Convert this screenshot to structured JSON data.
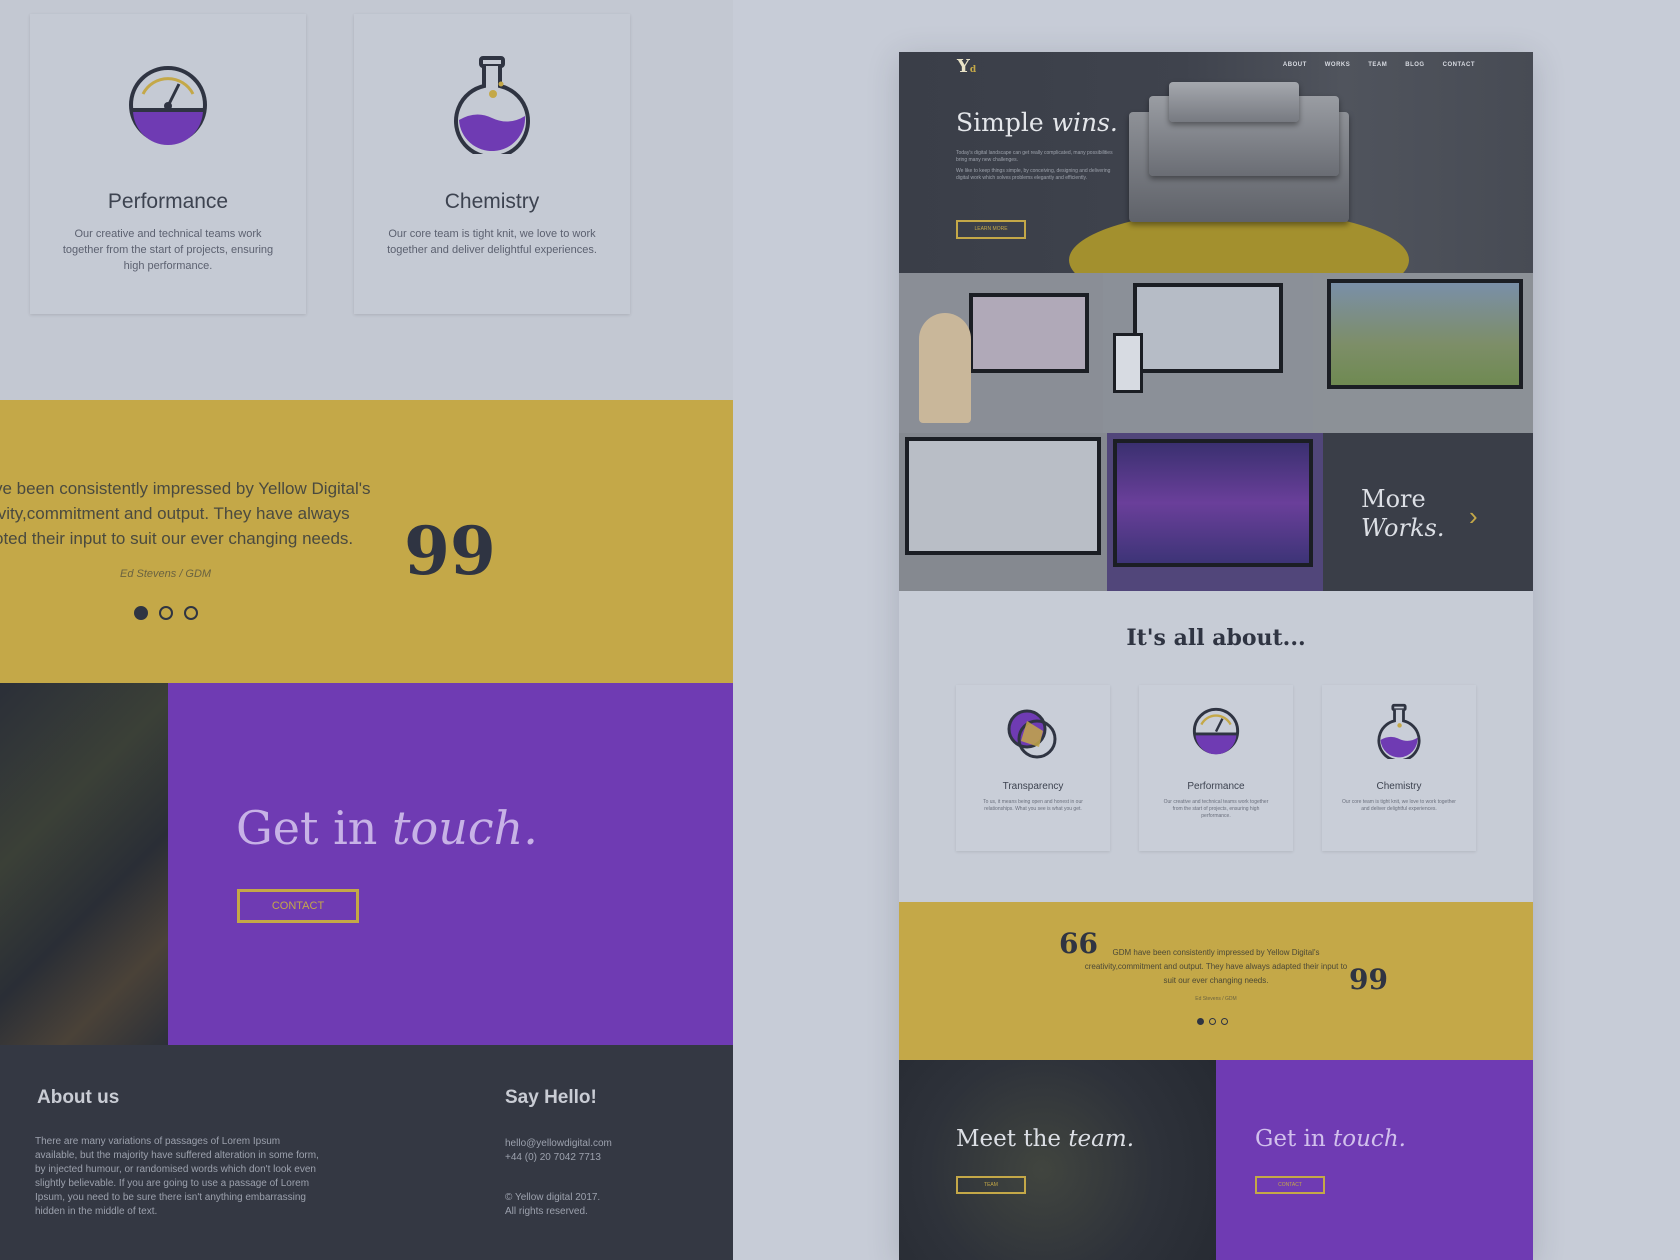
{
  "left": {
    "cards": [
      {
        "title": "Performance",
        "text": "Our creative and technical teams work together from the start of projects, ensuring high performance.",
        "icon": "gauge-icon"
      },
      {
        "title": "Chemistry",
        "text": "Our core team is tight knit, we love to work together and deliver delightful experiences.",
        "icon": "flask-icon"
      }
    ],
    "quote": {
      "line1": "ve been consistently impressed by Yellow Digital's",
      "line2": "ivity,commitment and output. They have always",
      "line3": "oted their input to suit our ever changing needs.",
      "mark": "99",
      "author": "Ed Stevens / GDM"
    },
    "contact": {
      "title_plain": "Get in ",
      "title_em": "touch.",
      "button": "CONTACT"
    },
    "footer": {
      "about_title": "About us",
      "about_text": "There are many variations of passages of Lorem Ipsum available, but the majority have suffered alteration in some form, by injected humour, or randomised words which don't look even slightly believable. If you are going to use a passage of Lorem Ipsum, you need to be sure there isn't anything embarrassing hidden in the middle of text.",
      "hello_title": "Say Hello!",
      "email": "hello@yellowdigital.com",
      "phone": "+44 (0) 20 7042 7713",
      "copyright": "© Yellow digital 2017.",
      "rights": "All rights reserved."
    }
  },
  "right": {
    "logo": "Y",
    "logo_small": "d",
    "nav": [
      "ABOUT",
      "WORKS",
      "TEAM",
      "BLOG",
      "CONTACT"
    ],
    "hero": {
      "title_plain": "Simple ",
      "title_em": "wins.",
      "desc1": "Today's digital landscape can get really complicated, many possibilities bring many new challenges.",
      "desc2": "We like to keep things simple, by conceiving, designing and delivering digital work which solves problems elegantly and efficiently.",
      "button": "LEARN MORE"
    },
    "more_works": {
      "line1": "More",
      "line2": "Works.",
      "chevron": "›"
    },
    "about": {
      "title": "It's all about...",
      "cards": [
        {
          "title": "Transparency",
          "text": "To us, it means being open and honest in our relationships. What you see is what you get.",
          "icon": "transparency-icon"
        },
        {
          "title": "Performance",
          "text": "Our creative and technical teams work together from the start of projects, ensuring high performance.",
          "icon": "gauge-icon"
        },
        {
          "title": "Chemistry",
          "text": "Our core team is tight knit, we love to work together and deliver delightful experiences.",
          "icon": "flask-icon"
        }
      ]
    },
    "quote": {
      "open": "66",
      "text": "GDM have been consistently impressed by Yellow Digital's creativity,commitment and output. They have always adapted their input to suit our ever changing needs.",
      "close": "99",
      "author": "Ed Stevens / GDM"
    },
    "team": {
      "title_plain": "Meet the ",
      "title_em": "team.",
      "button": "TEAM"
    },
    "touch": {
      "title_plain": "Get in ",
      "title_em": "touch.",
      "button": "CONTACT"
    }
  },
  "colors": {
    "yellow": "#c4a848",
    "purple": "#6f3bb3",
    "dark": "#343843",
    "light": "#c5cad4"
  }
}
